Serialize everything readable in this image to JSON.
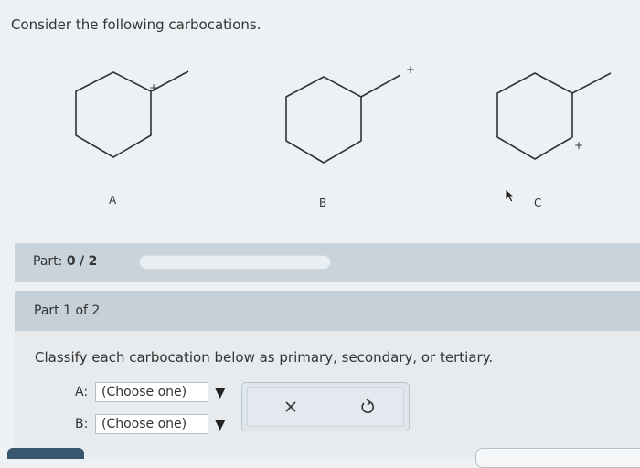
{
  "prompt": "Consider the following carbocations.",
  "structures": [
    {
      "id": "A",
      "label": "A",
      "charge": "+"
    },
    {
      "id": "B",
      "label": "B",
      "charge": "+"
    },
    {
      "id": "C",
      "label": "C",
      "charge": "+"
    }
  ],
  "part_progress": {
    "prefix": "Part:",
    "current": 0,
    "separator": "/",
    "total": 2,
    "fraction": 0
  },
  "part_header": "Part 1 of 2",
  "instruction": "Classify each carbocation below as primary, secondary, or tertiary.",
  "answers": [
    {
      "prefix": "A:",
      "selected": "(Choose one)"
    },
    {
      "prefix": "B:",
      "selected": "(Choose one)"
    }
  ],
  "icons": {
    "clear": "close-x-icon",
    "reset": "undo-icon",
    "dropdown": "triangle-down-icon"
  },
  "colors": {
    "part_bar": "#c9d3db",
    "part_header": "#c6d0d8",
    "progress_fill": "#7da3c4"
  }
}
